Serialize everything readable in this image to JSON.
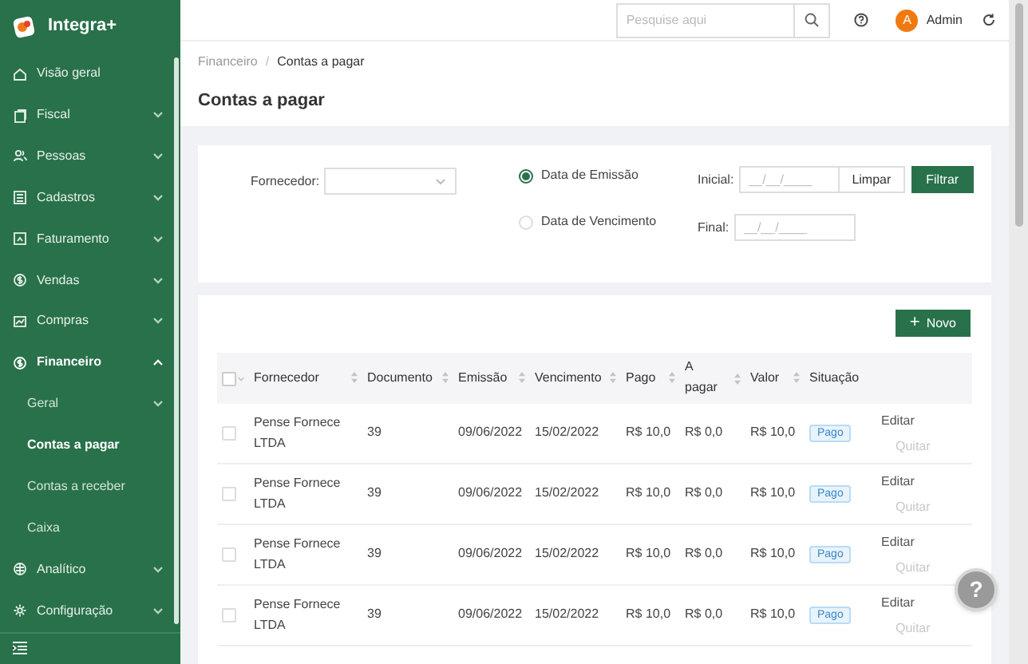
{
  "app": {
    "name": "Integra+"
  },
  "sidebar": {
    "items": [
      {
        "label": "Visão geral",
        "kind": "link"
      },
      {
        "label": "Fiscal",
        "kind": "submenu",
        "expanded": false
      },
      {
        "label": "Pessoas",
        "kind": "submenu",
        "expanded": false
      },
      {
        "label": "Cadastros",
        "kind": "submenu",
        "expanded": false
      },
      {
        "label": "Faturamento",
        "kind": "submenu",
        "expanded": false
      },
      {
        "label": "Vendas",
        "kind": "submenu",
        "expanded": false
      },
      {
        "label": "Compras",
        "kind": "submenu",
        "expanded": false
      },
      {
        "label": "Financeiro",
        "kind": "submenu",
        "expanded": true,
        "children": [
          {
            "label": "Geral",
            "kind": "submenu",
            "expanded": false,
            "selected": false
          },
          {
            "label": "Contas a pagar",
            "kind": "link",
            "selected": true
          },
          {
            "label": "Contas a receber",
            "kind": "link",
            "selected": false
          },
          {
            "label": "Caixa",
            "kind": "link",
            "selected": false
          }
        ]
      },
      {
        "label": "Analítico",
        "kind": "submenu",
        "expanded": false
      },
      {
        "label": "Configuração",
        "kind": "submenu",
        "expanded": false
      }
    ]
  },
  "header": {
    "search": {
      "placeholder": "Pesquise aqui"
    },
    "user": {
      "initial": "A",
      "name": "Admin"
    }
  },
  "breadcrumb": {
    "items": [
      "Financeiro",
      "Contas a pagar"
    ],
    "separator": "/"
  },
  "page_title": "Contas a pagar",
  "filter": {
    "supplier_label": "Fornecedor:",
    "date_types": [
      {
        "label": "Data de Emissão",
        "selected": true
      },
      {
        "label": "Data de Vencimento",
        "selected": false
      }
    ],
    "start": {
      "label": "Inicial:",
      "placeholder": "__/__/____"
    },
    "end": {
      "label": "Final:",
      "placeholder": "__/__/____"
    },
    "clear_button": "Limpar",
    "filter_button": "Filtrar"
  },
  "table": {
    "select_all_checked": false,
    "new_button": {
      "icon": "+",
      "label": "Novo"
    },
    "columns": [
      {
        "label": "Fornecedor",
        "sortable": true
      },
      {
        "label": "Documento",
        "sortable": true
      },
      {
        "label": "Emissão",
        "sortable": true
      },
      {
        "label": "Vencimento",
        "sortable": true
      },
      {
        "label": "Pago",
        "sortable": true
      },
      {
        "label": "A pagar",
        "sortable": true
      },
      {
        "label": "Valor",
        "sortable": true
      },
      {
        "label": "Situação",
        "sortable": false
      }
    ],
    "rows": [
      {
        "checked": false,
        "cells": [
          "Pense Fornece LTDA",
          "39",
          "09/06/2022",
          "15/02/2022",
          "R$ 10,0",
          "R$ 0,0",
          "R$ 10,0"
        ],
        "status": "Pago",
        "actions": [
          {
            "label": "Editar",
            "disabled": false
          },
          {
            "label": "Quitar",
            "disabled": true
          }
        ]
      },
      {
        "checked": false,
        "cells": [
          "Pense Fornece LTDA",
          "39",
          "09/06/2022",
          "15/02/2022",
          "R$ 10,0",
          "R$ 0,0",
          "R$ 10,0"
        ],
        "status": "Pago",
        "actions": [
          {
            "label": "Editar",
            "disabled": false
          },
          {
            "label": "Quitar",
            "disabled": true
          }
        ]
      },
      {
        "checked": false,
        "cells": [
          "Pense Fornece LTDA",
          "39",
          "09/06/2022",
          "15/02/2022",
          "R$ 10,0",
          "R$ 0,0",
          "R$ 10,0"
        ],
        "status": "Pago",
        "actions": [
          {
            "label": "Editar",
            "disabled": false
          },
          {
            "label": "Quitar",
            "disabled": true
          }
        ]
      },
      {
        "checked": false,
        "cells": [
          "Pense Fornece LTDA",
          "39",
          "09/06/2022",
          "15/02/2022",
          "R$ 10,0",
          "R$ 0,0",
          "R$ 10,0"
        ],
        "status": "Pago",
        "actions": [
          {
            "label": "Editar",
            "disabled": false
          },
          {
            "label": "Quitar",
            "disabled": true
          }
        ]
      }
    ]
  },
  "help_button": "?"
}
